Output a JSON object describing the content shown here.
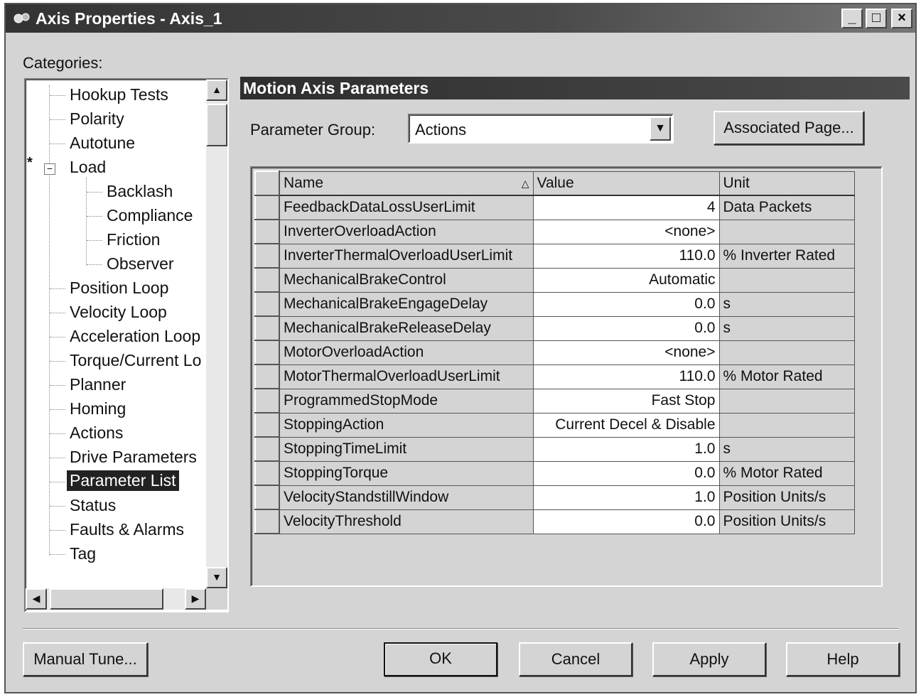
{
  "window": {
    "title": "Axis Properties - Axis_1",
    "minimize": "_",
    "maximize": "□",
    "close": "×"
  },
  "categories": {
    "label": "Categories:",
    "items": [
      "Hookup Tests",
      "Polarity",
      "Autotune",
      "Load",
      "Backlash",
      "Compliance",
      "Friction",
      "Observer",
      "Position Loop",
      "Velocity Loop",
      "Acceleration Loop",
      "Torque/Current Lo",
      "Planner",
      "Homing",
      "Actions",
      "Drive Parameters",
      "Parameter List",
      "Status",
      "Faults & Alarms",
      "Tag"
    ],
    "selected": "Parameter List",
    "modified_marker": "*",
    "expander": "−"
  },
  "main": {
    "header": "Motion Axis Parameters",
    "parameter_group_label": "Parameter Group:",
    "parameter_group_value": "Actions",
    "associated_page_button": "Associated Page..."
  },
  "grid": {
    "headers": {
      "name": "Name",
      "value": "Value",
      "unit": "Unit"
    },
    "rows": [
      {
        "name": "FeedbackDataLossUserLimit",
        "value": "4",
        "unit": "Data Packets"
      },
      {
        "name": "InverterOverloadAction",
        "value": "<none>",
        "unit": ""
      },
      {
        "name": "InverterThermalOverloadUserLimit",
        "value": "110.0",
        "unit": "% Inverter Rated"
      },
      {
        "name": "MechanicalBrakeControl",
        "value": "Automatic",
        "unit": ""
      },
      {
        "name": "MechanicalBrakeEngageDelay",
        "value": "0.0",
        "unit": "s"
      },
      {
        "name": "MechanicalBrakeReleaseDelay",
        "value": "0.0",
        "unit": "s"
      },
      {
        "name": "MotorOverloadAction",
        "value": "<none>",
        "unit": ""
      },
      {
        "name": "MotorThermalOverloadUserLimit",
        "value": "110.0",
        "unit": "% Motor Rated"
      },
      {
        "name": "ProgrammedStopMode",
        "value": "Fast Stop",
        "unit": ""
      },
      {
        "name": "StoppingAction",
        "value": "Current Decel & Disable",
        "unit": ""
      },
      {
        "name": "StoppingTimeLimit",
        "value": "1.0",
        "unit": "s"
      },
      {
        "name": "StoppingTorque",
        "value": "0.0",
        "unit": "% Motor Rated"
      },
      {
        "name": "VelocityStandstillWindow",
        "value": "1.0",
        "unit": "Position Units/s"
      },
      {
        "name": "VelocityThreshold",
        "value": "0.0",
        "unit": "Position Units/s"
      }
    ]
  },
  "buttons": {
    "manual_tune": "Manual Tune...",
    "ok": "OK",
    "cancel": "Cancel",
    "apply": "Apply",
    "help": "Help"
  }
}
